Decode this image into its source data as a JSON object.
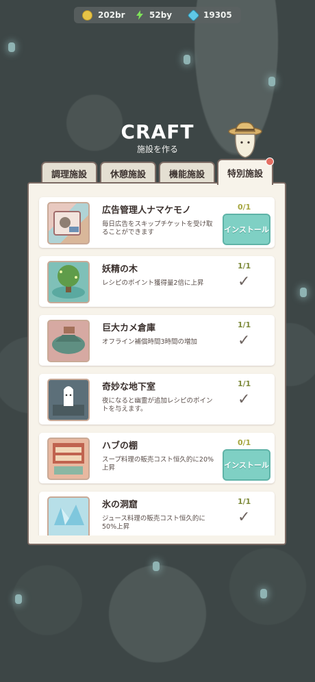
{
  "currency": {
    "coins": "202br",
    "energy": "52by",
    "gems": "19305"
  },
  "header": {
    "title": "CRAFT",
    "subtitle": "施設を作る"
  },
  "tabs": [
    {
      "label": "調理施設"
    },
    {
      "label": "休憩施設"
    },
    {
      "label": "機能施設"
    },
    {
      "label": "特別施設"
    }
  ],
  "items": [
    {
      "name": "広告管理人ナマケモノ",
      "desc": "毎日広告をスキップチケットを受け取ることができます",
      "count": "0/1",
      "state": "install",
      "button": "インストール"
    },
    {
      "name": "妖精の木",
      "desc": "レシピのポイント獲得量2倍に上昇",
      "count": "1/1",
      "state": "done",
      "check": "✓"
    },
    {
      "name": "巨大カメ倉庫",
      "desc": "オフライン補償時間3時間の増加",
      "count": "1/1",
      "state": "done",
      "check": "✓"
    },
    {
      "name": "奇妙な地下室",
      "desc": "夜になると幽霊が追加レシピのポイントを与えます。",
      "count": "1/1",
      "state": "done",
      "check": "✓"
    },
    {
      "name": "ハブの棚",
      "desc": "スープ料理の販売コスト恒久的に20%上昇",
      "count": "0/1",
      "state": "install",
      "button": "インストール"
    },
    {
      "name": "氷の洞窟",
      "desc": "ジュース料理の販売コスト恒久的に50%上昇",
      "count": "1/1",
      "state": "done",
      "check": "✓"
    }
  ],
  "colors": {
    "panel": "#f7f3ea",
    "install": "#7fd0c4",
    "count_zero": "#a6a63f",
    "count_done": "#7d8a3a"
  }
}
